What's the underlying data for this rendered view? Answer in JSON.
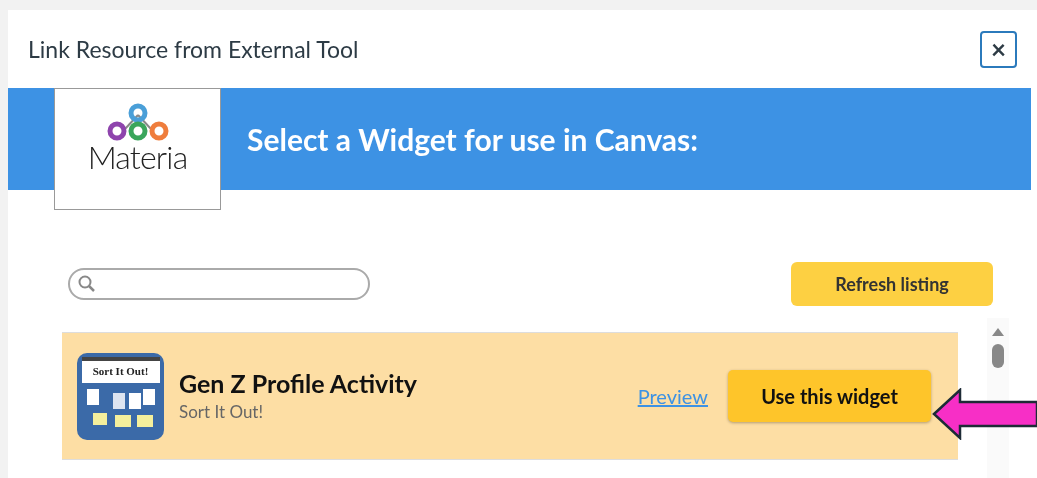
{
  "dialog": {
    "title": "Link Resource from External Tool",
    "close_label": "×"
  },
  "banner": {
    "logo_text": "Materia",
    "heading": "Select a Widget for use in Canvas:"
  },
  "refresh_button": "Refresh listing",
  "widgets": [
    {
      "name": "Gen Z Profile Activity",
      "type": "Sort It Out!",
      "thumbnail_text": "Sort It Out!",
      "selected": true,
      "preview_link": "Preview",
      "use_button": "Use this widget"
    }
  ]
}
